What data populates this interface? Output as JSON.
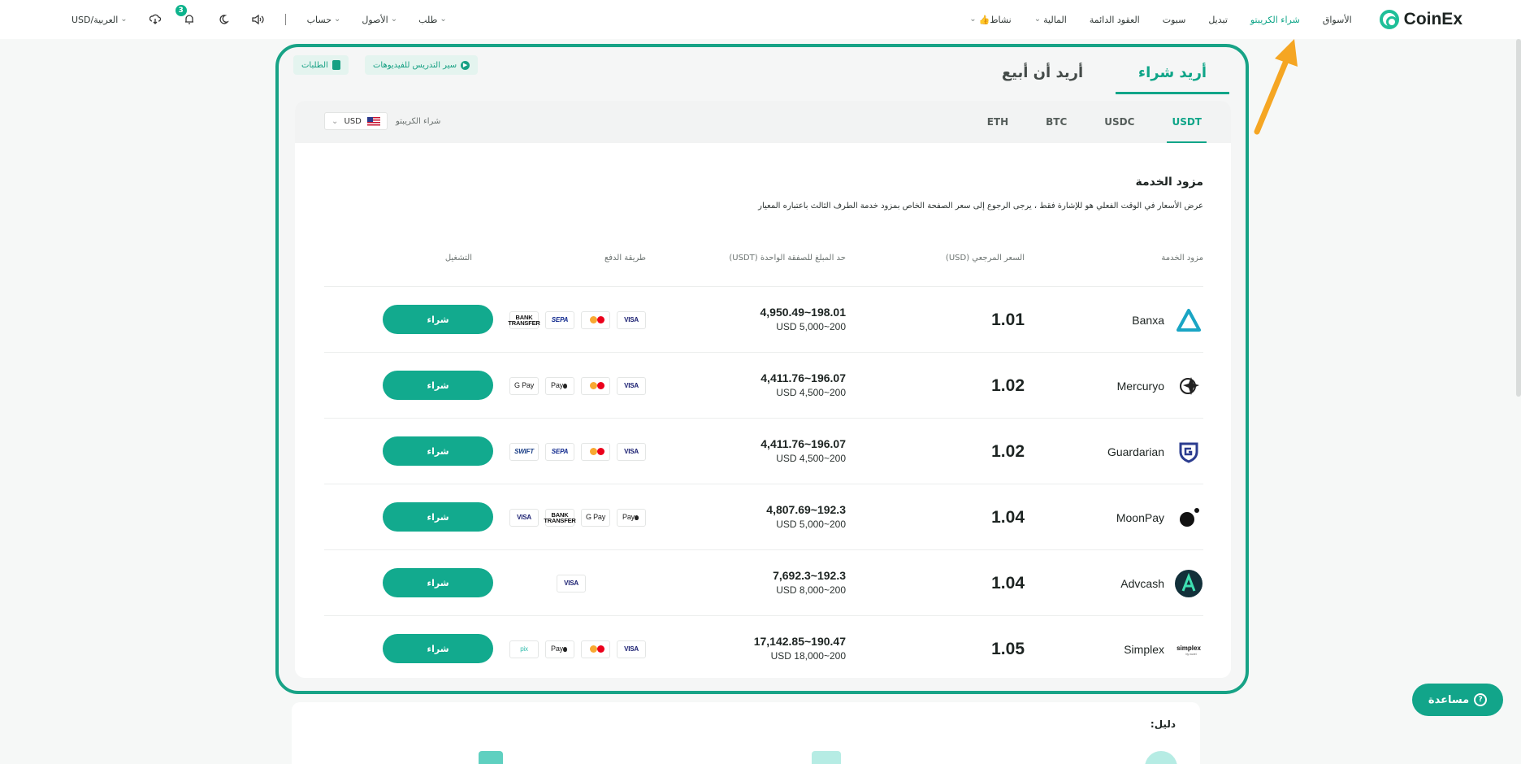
{
  "nav": {
    "logo": "CoinEx",
    "right_items": [
      {
        "label": "الأسواق",
        "active": false,
        "dropdown": false
      },
      {
        "label": "شراء الكريبتو",
        "active": true,
        "dropdown": false
      },
      {
        "label": "تبديل",
        "active": false,
        "dropdown": false
      },
      {
        "label": "سبوت",
        "active": false,
        "dropdown": false
      },
      {
        "label": "العقود الدائمة",
        "active": false,
        "dropdown": false
      },
      {
        "label": "المالية",
        "active": false,
        "dropdown": true
      },
      {
        "label": "👍نشاط",
        "active": false,
        "dropdown": true
      }
    ],
    "left": {
      "language_currency": "USD/العربية",
      "notifications_count": "3",
      "order": "طلب",
      "account": "حساب",
      "assets": "الأصول"
    }
  },
  "trade_tabs": {
    "buy": "أريد شراء",
    "sell": "أريد أن أبيع"
  },
  "pills": {
    "video_tutorial": "سير التدريس للفيديوهات",
    "orders": "الطلبات"
  },
  "coins": [
    "USDT",
    "USDC",
    "BTC",
    "ETH"
  ],
  "active_coin": "USDT",
  "fiat": {
    "label": "شراء الكريبتو",
    "currency": "USD"
  },
  "providers_section": {
    "title": "مزود الخدمة",
    "note": "عرض الأسعار في الوقت الفعلي هو للإشارة فقط ، يرجى الرجوع إلى سعر الصفحة الخاص بمزود خدمة الطرف الثالث باعتباره المعيار"
  },
  "table": {
    "headers": {
      "provider": "مزود الخدمة",
      "price": "السعر المرجعي (USD)",
      "limit": "حد المبلغ للصفقة الواحدة (USDT)",
      "payment": "طريقة الدفع",
      "action": "التشغيل"
    },
    "buy_label": "شراء",
    "rows": [
      {
        "provider": "Banxa",
        "logo": "banxa-logo-icon",
        "price": "1.01",
        "limit_usdt": "4,950.49~198.01",
        "limit_usd": "USD 5,000~200",
        "payments": [
          {
            "key": "visa",
            "text": "VISA"
          },
          {
            "key": "mc",
            "text": ""
          },
          {
            "key": "sepa",
            "text": "SEPA"
          },
          {
            "key": "bank",
            "text": "BANK TRANSFER"
          }
        ]
      },
      {
        "provider": "Mercuryo",
        "logo": "mercuryo-logo-icon",
        "price": "1.02",
        "limit_usdt": "4,411.76~196.07",
        "limit_usd": "USD 4,500~200",
        "payments": [
          {
            "key": "visa",
            "text": "VISA"
          },
          {
            "key": "mc",
            "text": ""
          },
          {
            "key": "apple",
            "text": "Pay"
          },
          {
            "key": "google",
            "text": "G Pay"
          }
        ]
      },
      {
        "provider": "Guardarian",
        "logo": "guardarian-logo-icon",
        "price": "1.02",
        "limit_usdt": "4,411.76~196.07",
        "limit_usd": "USD 4,500~200",
        "payments": [
          {
            "key": "visa",
            "text": "VISA"
          },
          {
            "key": "mc",
            "text": ""
          },
          {
            "key": "sepa",
            "text": "SEPA"
          },
          {
            "key": "swift",
            "text": "SWIFT"
          }
        ]
      },
      {
        "provider": "MoonPay",
        "logo": "moonpay-logo-icon",
        "price": "1.04",
        "limit_usdt": "4,807.69~192.3",
        "limit_usd": "USD 5,000~200",
        "payments": [
          {
            "key": "apple",
            "text": "Pay"
          },
          {
            "key": "google",
            "text": "G Pay"
          },
          {
            "key": "bank",
            "text": "BANK TRANSFER"
          },
          {
            "key": "visa",
            "text": "VISA"
          }
        ]
      },
      {
        "provider": "Advcash",
        "logo": "advcash-logo-icon",
        "price": "1.04",
        "limit_usdt": "7,692.3~192.3",
        "limit_usd": "USD 8,000~200",
        "payments": [
          {
            "key": "visa",
            "text": "VISA",
            "center": true
          }
        ]
      },
      {
        "provider": "Simplex",
        "logo": "simplex-logo-icon",
        "price": "1.05",
        "limit_usdt": "17,142.85~190.47",
        "limit_usd": "USD 18,000~200",
        "payments": [
          {
            "key": "visa",
            "text": "VISA"
          },
          {
            "key": "mc",
            "text": ""
          },
          {
            "key": "apple",
            "text": "Pay"
          },
          {
            "key": "pix",
            "text": "pix"
          }
        ]
      }
    ]
  },
  "guide": {
    "title": "دليل:"
  },
  "help": {
    "label": "مساعدة"
  },
  "colors": {
    "accent": "#12aa8e",
    "highlight_border": "#17a386",
    "arrow": "#f5a623"
  }
}
